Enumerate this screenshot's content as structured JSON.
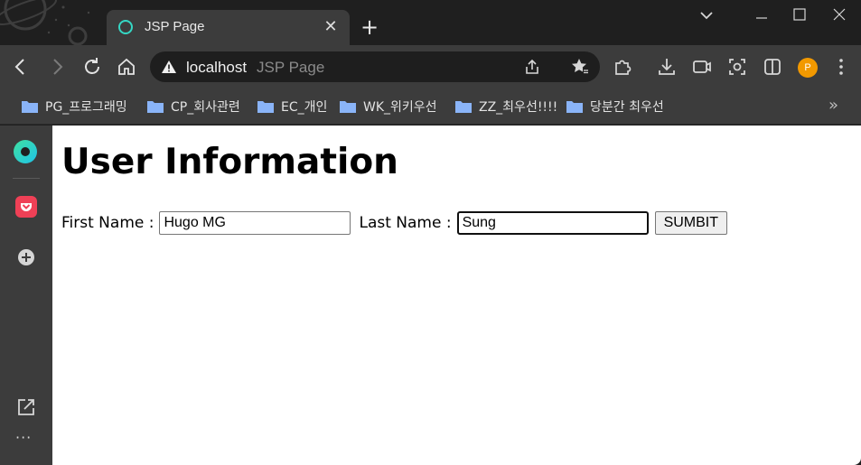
{
  "browser": {
    "tab": {
      "title": "JSP Page",
      "close_glyph": "✕"
    },
    "new_tab_glyph": "+",
    "window_controls": {
      "dropdown": "⌄",
      "minimize": "—",
      "maximize": "☐",
      "close": "✕"
    },
    "address_bar": {
      "host": "localhost",
      "page_title": "JSP Page"
    },
    "profile_initial": "P",
    "bookmarks": [
      {
        "label": "PG_프로그래밍"
      },
      {
        "label": "CP_회사관련"
      },
      {
        "label": "EC_개인"
      },
      {
        "label": "WK_위키우선"
      },
      {
        "label": "ZZ_최우선!!!!"
      },
      {
        "label": "당분간 최우선"
      }
    ],
    "bookmarks_overflow": "»",
    "side_panel": {
      "more_glyph": "···"
    }
  },
  "page": {
    "heading": "User Information",
    "first_name": {
      "label": "First Name :",
      "value": "Hugo MG"
    },
    "last_name": {
      "label": "Last Name :",
      "value": "Sung"
    },
    "submit_label": "SUMBIT"
  },
  "colors": {
    "accent_teal": "#35d7c4",
    "pocket_red": "#ef4056",
    "profile_orange": "#f29900",
    "folder_blue": "#8ab4f8"
  }
}
